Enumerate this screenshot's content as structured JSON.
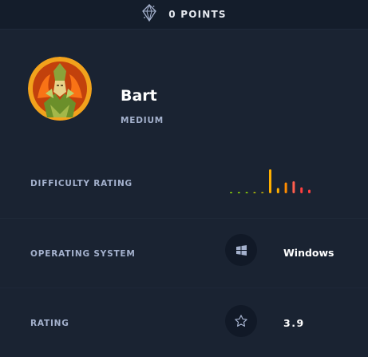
{
  "header": {
    "points_label": "0 POINTS",
    "icon": "diamond-icon"
  },
  "machine": {
    "name": "Bart",
    "difficulty": "MEDIUM",
    "avatar_icon": "avatar-warrior-icon"
  },
  "difficulty_rating": {
    "label": "DIFFICULTY RATING",
    "bars": [
      {
        "value": 0.03,
        "color": "#9fef00"
      },
      {
        "value": 0.03,
        "color": "#9fef00"
      },
      {
        "value": 0.03,
        "color": "#9fef00"
      },
      {
        "value": 0.03,
        "color": "#c8d400"
      },
      {
        "value": 0.05,
        "color": "#d8c100"
      },
      {
        "value": 1.0,
        "color": "#ffaf00"
      },
      {
        "value": 0.22,
        "color": "#ffaf00"
      },
      {
        "value": 0.45,
        "color": "#ff8c00"
      },
      {
        "value": 0.5,
        "color": "#ff5e4e"
      },
      {
        "value": 0.25,
        "color": "#ff3e3e"
      },
      {
        "value": 0.15,
        "color": "#ff3e3e"
      }
    ]
  },
  "operating_system": {
    "label": "OPERATING SYSTEM",
    "value": "Windows",
    "icon": "windows-icon"
  },
  "rating": {
    "label": "RATING",
    "value": "3.9",
    "icon": "star-icon"
  }
}
